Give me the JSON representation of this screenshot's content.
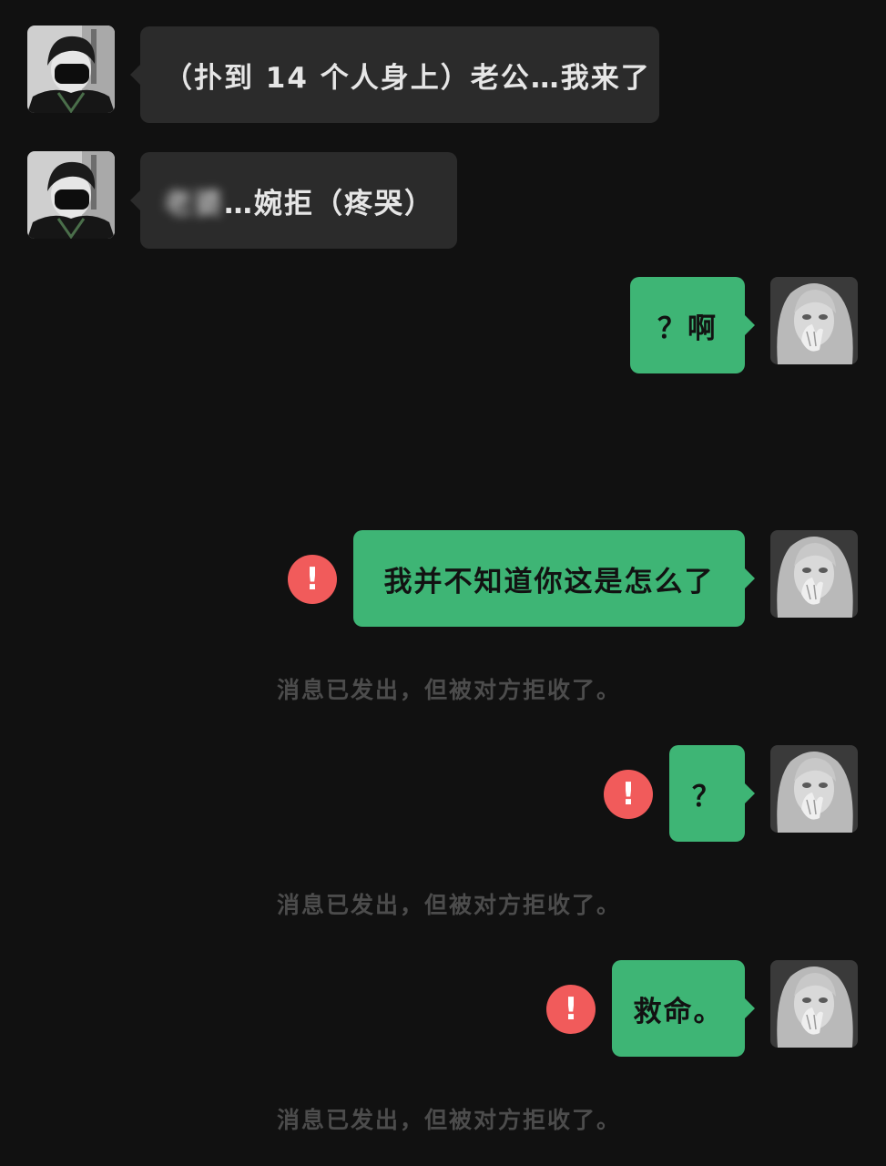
{
  "messages": [
    {
      "side": "incoming",
      "text": "（扑到 14 个人身上）老公…我来了"
    },
    {
      "side": "incoming",
      "obscured_text": "老婆",
      "text": "…婉拒（疼哭）"
    },
    {
      "side": "outgoing",
      "text": "？啊"
    },
    {
      "side": "outgoing",
      "text": "我并不知道你这是怎么了",
      "error_icon": "!",
      "notice": "消息已发出，但被对方拒收了。"
    },
    {
      "side": "outgoing",
      "text": "？",
      "error_icon": "!",
      "notice": "消息已发出，但被对方拒收了。"
    },
    {
      "side": "outgoing",
      "text": "救命。",
      "error_icon": "!",
      "notice": "消息已发出，但被对方拒收了。"
    }
  ],
  "icons": {
    "incoming_avatar": "masked-boy-avatar-icon",
    "outgoing_avatar": "blonde-girl-avatar-icon",
    "error": "red-exclamation-icon"
  },
  "colors": {
    "background": "#111111",
    "incoming_bubble": "#2b2b2b",
    "outgoing_bubble": "#3eb575",
    "error_badge": "#f15b5b",
    "notice_text": "#4c4c4c"
  }
}
